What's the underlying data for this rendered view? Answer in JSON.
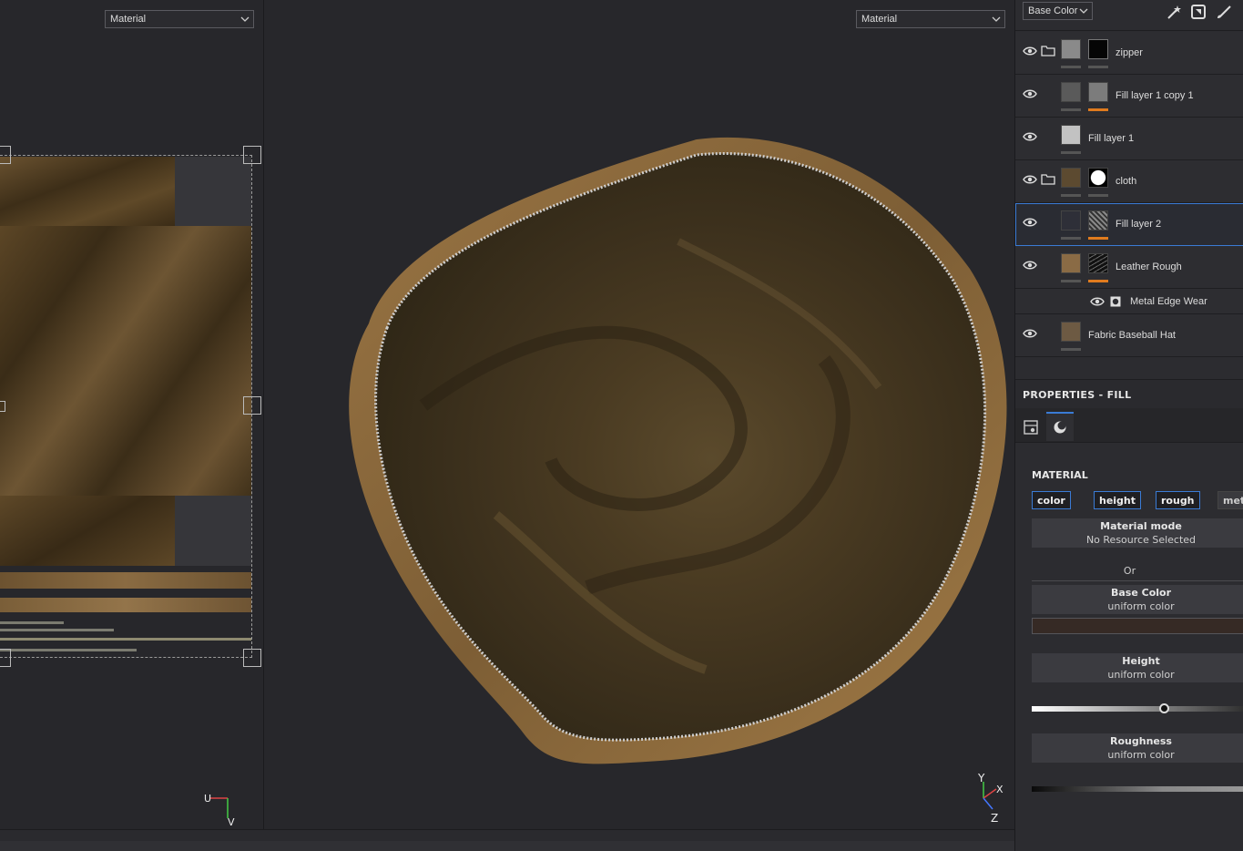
{
  "viewport2d": {
    "mode": "Material",
    "uv_axis": {
      "u": "U",
      "v": "V"
    }
  },
  "viewport3d": {
    "mode": "Material",
    "axes": {
      "y": "Y",
      "x": "X",
      "z": "Z"
    }
  },
  "toolbar": {
    "channel": "Base Color",
    "icons": [
      "magic-wand-icon",
      "paint-bucket-icon",
      "brush-icon"
    ]
  },
  "layers": [
    {
      "name": "zipper",
      "type": "folder",
      "visible": true
    },
    {
      "name": "Fill layer 1 copy 1",
      "type": "fill",
      "visible": true
    },
    {
      "name": "Fill layer 1",
      "type": "fill",
      "visible": true
    },
    {
      "name": "cloth",
      "type": "folder",
      "visible": true
    },
    {
      "name": "Fill layer 2",
      "type": "fill",
      "visible": true,
      "selected": true
    },
    {
      "name": "Leather Rough",
      "type": "fill",
      "visible": true
    },
    {
      "name": "Metal Edge Wear",
      "type": "effect",
      "visible": true
    },
    {
      "name": "Fabric Baseball Hat",
      "type": "fill",
      "visible": true
    }
  ],
  "properties": {
    "header": "PROPERTIES - FILL",
    "section": "MATERIAL",
    "channels": [
      "color",
      "height",
      "rough",
      "meta"
    ],
    "material_mode": {
      "title": "Material mode",
      "value": "No Resource Selected"
    },
    "or_label": "Or",
    "base_color": {
      "title": "Base Color",
      "value": "uniform color",
      "color": "#362a25"
    },
    "height": {
      "title": "Height",
      "value": "uniform color",
      "level": 0.6
    },
    "roughness": {
      "title": "Roughness",
      "value": "uniform color"
    }
  },
  "colors": {
    "accent": "#3a7bd5",
    "mask_bar": "#e07b1e",
    "panel_bg": "#2c2c30",
    "viewport_bg": "#27272b"
  }
}
